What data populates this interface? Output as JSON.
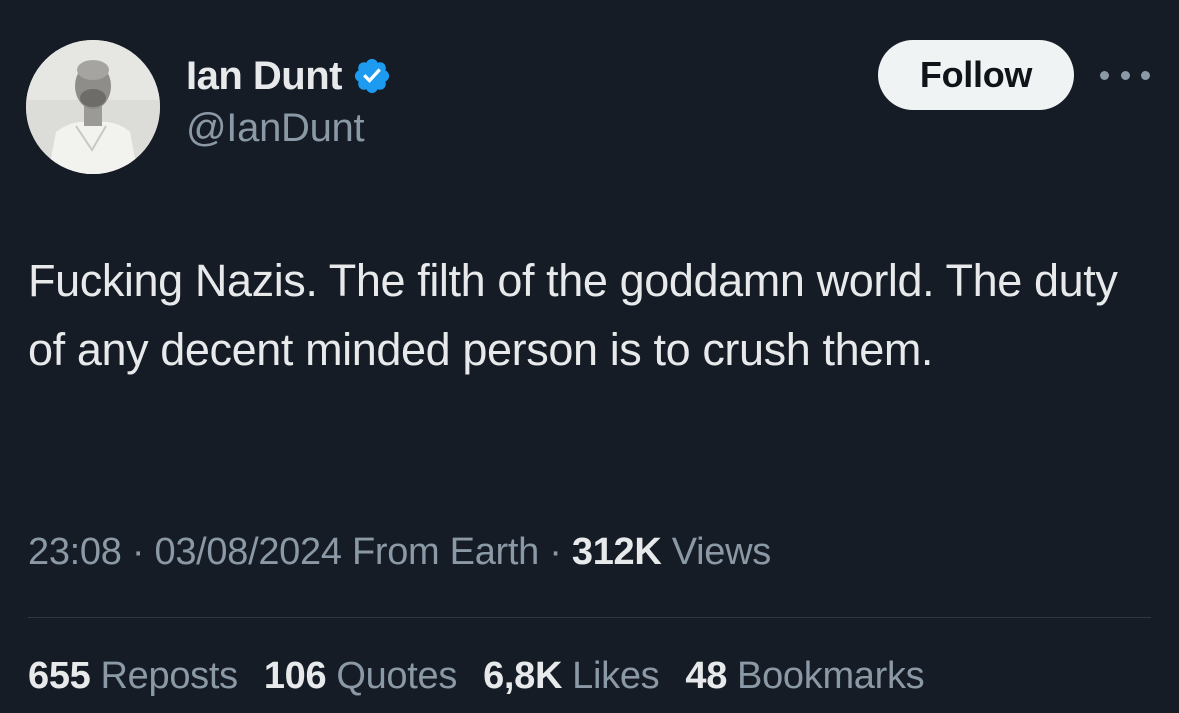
{
  "author": {
    "name": "Ian Dunt",
    "handle": "@IanDunt",
    "verified": true,
    "avatar": "profile-photo"
  },
  "follow_label": "Follow",
  "more_icon": "more-horizontal-icon",
  "tweet": {
    "text": "Fucking Nazis. The filth of the goddamn world. The duty of any decent minded person is to crush them."
  },
  "meta": {
    "time": "23:08",
    "date": "03/08/2024",
    "location": "From Earth",
    "views_count": "312K",
    "views_label": "Views",
    "separator": "·"
  },
  "stats": [
    {
      "count": "655",
      "label": "Reposts"
    },
    {
      "count": "106",
      "label": "Quotes"
    },
    {
      "count": "6,8K",
      "label": "Likes"
    },
    {
      "count": "48",
      "label": "Bookmarks"
    }
  ],
  "colors": {
    "background": "#151c26",
    "text": "#e7e9ea",
    "secondary": "#8b98a5",
    "verified": "#1d9bf0",
    "follow_bg": "#eff3f4"
  }
}
